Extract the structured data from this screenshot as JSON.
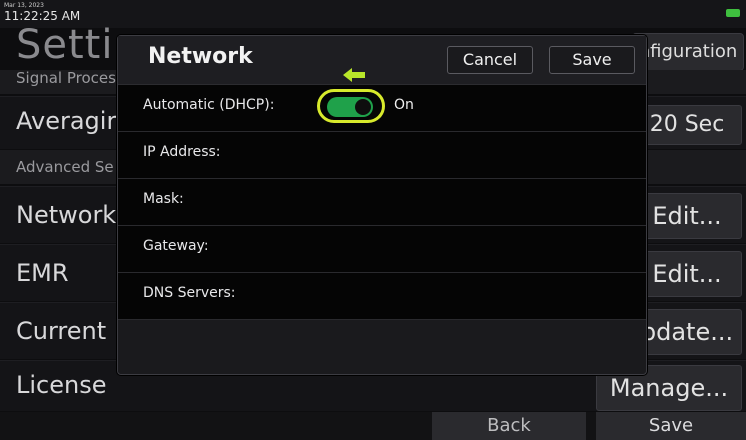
{
  "status": {
    "date": "Mar 13, 2023",
    "time": "11:22:25 AM"
  },
  "page": {
    "title": "Settir",
    "config_button": "nfiguration"
  },
  "sections": {
    "signal_processing": "Signal Proces",
    "advanced": "Advanced Se"
  },
  "rows": [
    {
      "label": "Averagir",
      "button": "20 Sec"
    },
    {
      "label": "Network",
      "button": "Edit..."
    },
    {
      "label": "EMR",
      "button": "Edit..."
    },
    {
      "label": "Current",
      "button": "pdate..."
    },
    {
      "label": "License",
      "button": "Manage..."
    }
  ],
  "bottom": {
    "back": "Back",
    "save": "Save"
  },
  "modal": {
    "title": "Network",
    "cancel": "Cancel",
    "save": "Save",
    "dhcp_label": "Automatic (DHCP):",
    "dhcp_state": "On",
    "dhcp_enabled": true,
    "fields": [
      "IP Address:",
      "Mask:",
      "Gateway:",
      "DNS Servers:"
    ]
  },
  "colors": {
    "toggle_on": "#1fa14a",
    "highlight": "#d8ea2c",
    "battery": "#3fbf3f"
  },
  "icons": {
    "battery": "battery-icon",
    "hint": "arrow-left-icon"
  }
}
